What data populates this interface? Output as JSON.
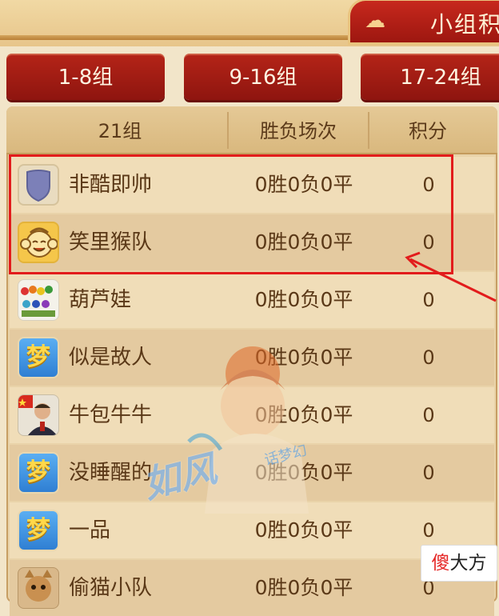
{
  "header": {
    "title": "小组积"
  },
  "group_tabs": [
    {
      "label": "1-8组"
    },
    {
      "label": "9-16组"
    },
    {
      "label": "17-24组"
    }
  ],
  "table": {
    "columns": [
      "21组",
      "胜负场次",
      "积分"
    ],
    "rows": [
      {
        "name": "非酷即帅",
        "record": "0胜0负0平",
        "points": "0",
        "avatar": "shield-icon"
      },
      {
        "name": "笑里猴队",
        "record": "0胜0负0平",
        "points": "0",
        "avatar": "monkey-icon"
      },
      {
        "name": "葫芦娃",
        "record": "0胜0负0平",
        "points": "0",
        "avatar": "gourd-brothers-icon"
      },
      {
        "name": "似是故人",
        "record": "0胜0负0平",
        "points": "0",
        "avatar": "dream-icon"
      },
      {
        "name": "牛包牛牛",
        "record": "0胜0负0平",
        "points": "0",
        "avatar": "portrait-photo"
      },
      {
        "name": "没睡醒的",
        "record": "0胜0负0平",
        "points": "0",
        "avatar": "dream-icon"
      },
      {
        "name": "一品",
        "record": "0胜0负0平",
        "points": "0",
        "avatar": "dream-icon"
      },
      {
        "name": "偷猫小队",
        "record": "0胜0负0平",
        "points": "0",
        "avatar": "cat-icon"
      }
    ]
  },
  "dream_glyph": "梦",
  "watermark": {
    "main": "如风",
    "sub": "话梦幻"
  },
  "site_badge": {
    "part1": "傻",
    "part2": "大方"
  },
  "colors": {
    "tab_red": "#a51c13",
    "highlight_red": "#e21c1c",
    "text_brown": "#5a3817"
  }
}
